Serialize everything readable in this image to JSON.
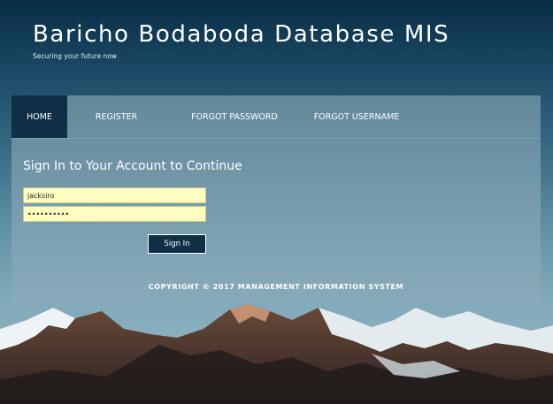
{
  "header": {
    "title": "Baricho Bodaboda Database MIS",
    "tagline": "Securing your future now"
  },
  "nav": {
    "items": [
      {
        "label": "HOME",
        "active": true
      },
      {
        "label": "REGISTER",
        "active": false
      },
      {
        "label": "FORGOT PASSWORD",
        "active": false
      },
      {
        "label": "FORGOT USERNAME",
        "active": false
      }
    ]
  },
  "login": {
    "heading": "Sign In to Your Account to Continue",
    "username_value": "jacksiro",
    "password_value": "••••••••••",
    "submit_label": "Sign In"
  },
  "footer": {
    "copyright": "COPYRIGHT © 2017 MANAGEMENT INFORMATION SYSTEM"
  },
  "colors": {
    "nav_active_bg": "#0f2f47",
    "input_bg": "#fdfdc0",
    "button_bg": "#0f2f47"
  }
}
